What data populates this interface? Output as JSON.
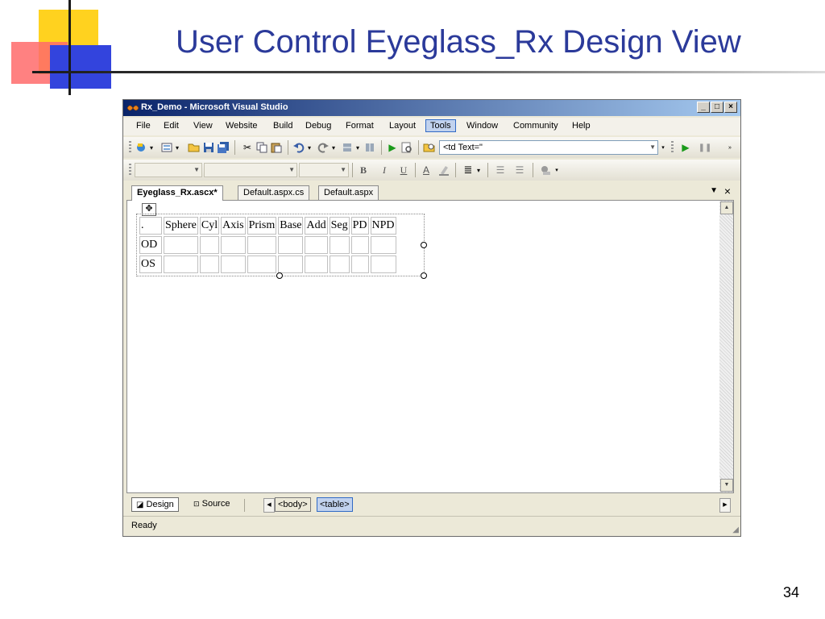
{
  "slide": {
    "title": "User Control Eyeglass_Rx Design View",
    "page_number": "34",
    "colors": {
      "title": "#2b3a9a",
      "yellow": "#ffd21f",
      "red": "#ff6b6b",
      "blue": "#3344dd"
    }
  },
  "window": {
    "title": "Rx_Demo - Microsoft Visual Studio",
    "controls": {
      "minimize": "_",
      "maximize": "□",
      "close": "×"
    }
  },
  "menu": [
    "File",
    "Edit",
    "View",
    "Website",
    "Build",
    "Debug",
    "Format",
    "Layout",
    "Tools",
    "Window",
    "Community",
    "Help"
  ],
  "toolbar": {
    "combo_value": "<td Text=\""
  },
  "toolbar2": {
    "bold": "B",
    "italic": "I",
    "underline": "U",
    "font_color": "A"
  },
  "doc_tabs": [
    "Eyeglass_Rx.ascx*",
    "Default.aspx.cs",
    "Default.aspx"
  ],
  "rx_table": {
    "header": [
      ".",
      "Sphere",
      "Cyl",
      "Axis",
      "Prism",
      "Base",
      "Add",
      "Seg",
      "PD",
      "NPD"
    ],
    "rows": [
      {
        "label": "OD"
      },
      {
        "label": "OS"
      }
    ]
  },
  "view": {
    "design": "Design",
    "source": "Source"
  },
  "breadcrumbs": [
    "<body>",
    "<table>"
  ],
  "status": "Ready"
}
